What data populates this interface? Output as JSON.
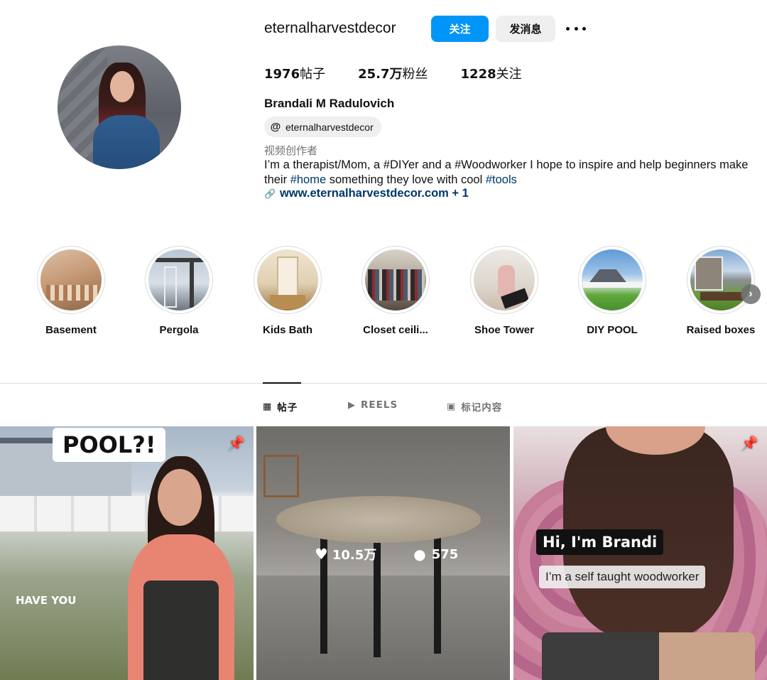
{
  "profile": {
    "username": "eternalharvestdecor",
    "follow_label": "关注",
    "message_label": "发消息",
    "stats": [
      {
        "value": "1976",
        "unit": "帖子"
      },
      {
        "value": "25.7万",
        "unit": "粉丝"
      },
      {
        "value": "1228",
        "unit": "关注"
      }
    ],
    "full_name": "Brandali M Radulovich",
    "threads_handle": "eternalharvestdecor",
    "category": "视频创作者",
    "bio_part1": "I’m a therapist/Mom, a #DIYer and a #Woodworker I hope to inspire and help beginners make their ",
    "bio_tag_home": "#home",
    "bio_part2": " something they love with cool ",
    "bio_tag_tools": "#tools",
    "link": "www.eternalharvestdecor.com + 1"
  },
  "highlights": [
    {
      "label": "Basement"
    },
    {
      "label": "Pergola"
    },
    {
      "label": "Kids Bath"
    },
    {
      "label": "Closet ceili..."
    },
    {
      "label": "Shoe Tower"
    },
    {
      "label": "DIY POOL"
    },
    {
      "label": "Raised boxes"
    }
  ],
  "tabs": [
    {
      "label": "帖子",
      "icon": "grid-icon",
      "active": true
    },
    {
      "label": "REELS",
      "icon": "reels-icon",
      "active": false
    },
    {
      "label": "标记内容",
      "icon": "tagged-icon",
      "active": false
    }
  ],
  "posts": [
    {
      "overlay_title": "POOL?!",
      "overlay_text": "HAVE YOU",
      "pinned": true
    },
    {
      "likes": "10.5万",
      "comments": "575",
      "pinned": false
    },
    {
      "caption_1": "Hi, I'm Brandi",
      "caption_2": "I’m a self taught woodworker",
      "pinned": true
    }
  ],
  "colors": {
    "accent": "#0095f6",
    "link": "#00376b",
    "muted": "#737373"
  }
}
